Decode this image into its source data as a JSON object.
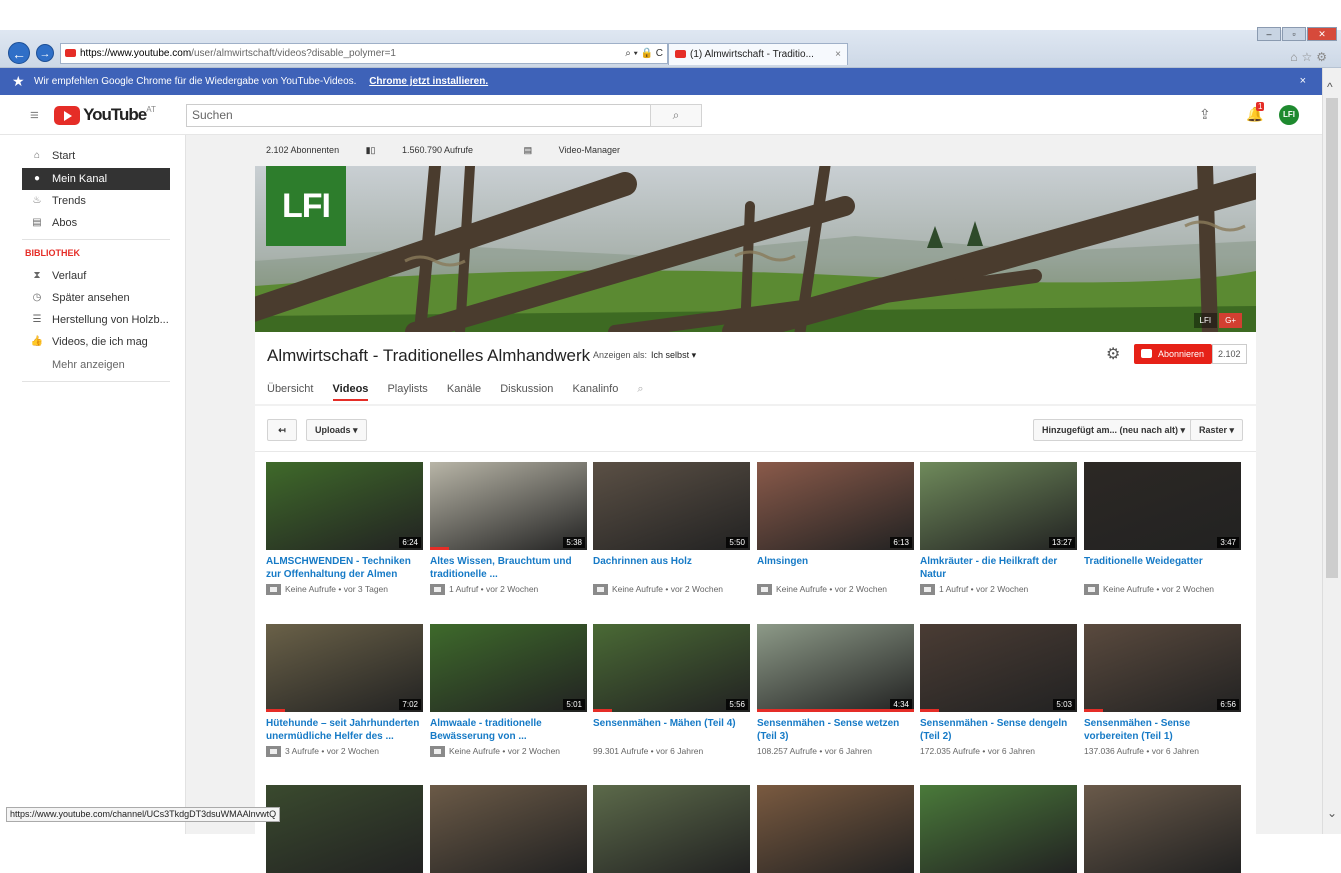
{
  "browser": {
    "address_domain": "https://www.youtube.com",
    "address_path": "/user/almwirtschaft/videos?disable_polymer=1",
    "address_controls": "⌕ ▾ 🔒 C",
    "tab_title": "(1) Almwirtschaft - Traditio...",
    "tab_close": "×"
  },
  "chrome_bar": {
    "text": "Wir empfehlen Google Chrome für die Wiedergabe von YouTube-Videos.",
    "link": "Chrome jetzt installieren.",
    "close": "×"
  },
  "masthead": {
    "logo_text": "YouTube",
    "country": "AT",
    "search_placeholder": "Suchen",
    "notifications_count": "1",
    "avatar_text": "LFI"
  },
  "sidebar": {
    "items": [
      {
        "label": "Start",
        "icon": "home-icon"
      },
      {
        "label": "Mein Kanal",
        "icon": "account-icon"
      },
      {
        "label": "Trends",
        "icon": "trending-icon"
      },
      {
        "label": "Abos",
        "icon": "subscriptions-icon"
      }
    ],
    "library_heading": "BIBLIOTHEK",
    "library": [
      {
        "label": "Verlauf",
        "icon": "history-icon"
      },
      {
        "label": "Später ansehen",
        "icon": "clock-icon"
      },
      {
        "label": "Herstellung von Holzb...",
        "icon": "playlist-icon"
      },
      {
        "label": "Videos, die ich mag",
        "icon": "thumb-up-icon"
      }
    ],
    "more": "Mehr anzeigen"
  },
  "channel": {
    "stats": {
      "subscribers": "2.102 Abonnenten",
      "views": "1.560.790 Aufrufe",
      "manager": "Video-Manager"
    },
    "logo_text": "LFI",
    "banner_link_lfi": "LFI",
    "banner_link_gplus": "G+",
    "title": "Almwirtschaft - Traditionelles Almhandwerk",
    "view_as_label": "Anzeigen als:",
    "view_as_value": "Ich selbst ▾",
    "subscribe_label": "Abonnieren",
    "subscribe_count": "2.102",
    "tabs": [
      "Übersicht",
      "Videos",
      "Playlists",
      "Kanäle",
      "Diskussion",
      "Kanalinfo"
    ]
  },
  "toolbar": {
    "back": "↤",
    "uploads": "Uploads ▾",
    "sort": "Hinzugefügt am... (neu nach alt) ▾",
    "view": "Raster ▾"
  },
  "videos": [
    {
      "title": "ALMSCHWENDEN - Techniken zur Offenhaltung der Almen",
      "duration": "6:24",
      "meta": "Keine Aufrufe • vor 3 Tagen",
      "locked": true,
      "watched": 0,
      "thumb": "#3f6a2a"
    },
    {
      "title": "Altes Wissen, Brauchtum und traditionelle ...",
      "duration": "5:38",
      "meta": "1 Aufruf • vor 2 Wochen",
      "locked": true,
      "watched": 0.12,
      "thumb": "#b8b5a7"
    },
    {
      "title": "Dachrinnen aus Holz",
      "duration": "5:50",
      "meta": "Keine Aufrufe • vor 2 Wochen",
      "locked": true,
      "watched": 0,
      "thumb": "#5b5045"
    },
    {
      "title": "Almsingen",
      "duration": "6:13",
      "meta": "Keine Aufrufe • vor 2 Wochen",
      "locked": true,
      "watched": 0,
      "thumb": "#8a5a4a"
    },
    {
      "title": "Almkräuter - die Heilkraft der Natur",
      "duration": "13:27",
      "meta": "1 Aufruf • vor 2 Wochen",
      "locked": true,
      "watched": 0,
      "thumb": "#6f8a5b"
    },
    {
      "title": "Traditionelle Weidegatter",
      "duration": "3:47",
      "meta": "Keine Aufrufe • vor 2 Wochen",
      "locked": true,
      "watched": 0,
      "thumb": "#2c2824"
    },
    {
      "title": "Hütehunde – seit Jahrhunderten unermüdliche Helfer des ...",
      "duration": "7:02",
      "meta": "3 Aufrufe • vor 2 Wochen",
      "locked": true,
      "watched": 0.12,
      "thumb": "#6a6148"
    },
    {
      "title": "Almwaale - traditionelle Bewässerung von ...",
      "duration": "5:01",
      "meta": "Keine Aufrufe • vor 2 Wochen",
      "locked": true,
      "watched": 0,
      "thumb": "#3e6a2b"
    },
    {
      "title": "Sensenmähen - Mähen (Teil 4)",
      "duration": "5:56",
      "meta": "99.301 Aufrufe • vor 6 Jahren",
      "locked": false,
      "watched": 0.12,
      "thumb": "#4a6a35"
    },
    {
      "title": "Sensenmähen - Sense wetzen (Teil 3)",
      "duration": "4:34",
      "meta": "108.257 Aufrufe • vor 6 Jahren",
      "locked": false,
      "watched": 1,
      "thumb": "#8d9a88"
    },
    {
      "title": "Sensenmähen - Sense dengeln (Teil 2)",
      "duration": "5:03",
      "meta": "172.035 Aufrufe • vor 6 Jahren",
      "locked": false,
      "watched": 0.12,
      "thumb": "#4a3c34"
    },
    {
      "title": "Sensenmähen - Sense vorbereiten (Teil 1)",
      "duration": "6:56",
      "meta": "137.036 Aufrufe • vor 6 Jahren",
      "locked": false,
      "watched": 0.12,
      "thumb": "#5a4a3e"
    },
    {
      "title": "",
      "duration": "",
      "meta": "",
      "locked": false,
      "watched": 0,
      "thumb": "#3a4a2e"
    },
    {
      "title": "",
      "duration": "",
      "meta": "",
      "locked": false,
      "watched": 0,
      "thumb": "#6b5a47"
    },
    {
      "title": "",
      "duration": "",
      "meta": "",
      "locked": false,
      "watched": 0,
      "thumb": "#5c6a4a"
    },
    {
      "title": "",
      "duration": "",
      "meta": "",
      "locked": false,
      "watched": 0,
      "thumb": "#7a5a40"
    },
    {
      "title": "",
      "duration": "",
      "meta": "",
      "locked": false,
      "watched": 0,
      "thumb": "#4a7a3a"
    },
    {
      "title": "",
      "duration": "",
      "meta": "",
      "locked": false,
      "watched": 0,
      "thumb": "#6a5a4a"
    }
  ],
  "statusbar": "https://www.youtube.com/channel/UCs3TkdgDT3dsuWMAAlnvwtQ"
}
